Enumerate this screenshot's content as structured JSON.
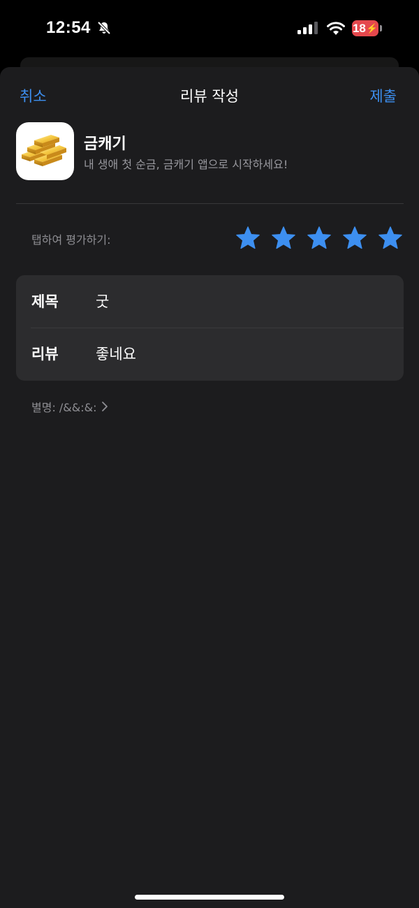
{
  "status_bar": {
    "time": "12:54",
    "battery_level": "18",
    "battery_color": "#e5484d",
    "icons": [
      "bell-slash-icon",
      "cellular-signal-icon",
      "wifi-icon",
      "battery-charging-icon"
    ]
  },
  "nav": {
    "cancel_label": "취소",
    "title": "리뷰 작성",
    "submit_label": "제출",
    "accent_color": "#3d8ff0"
  },
  "app": {
    "name": "금캐기",
    "subtitle": "내 생애 첫 순금, 금캐기 앱으로 시작하세요!",
    "icon": "gold-bars-icon"
  },
  "rating": {
    "label": "탭하여 평가하기:",
    "value": 5,
    "max": 5,
    "star_color": "#3d8ff0"
  },
  "form": {
    "title_label": "제목",
    "title_value": "굿",
    "review_label": "리뷰",
    "review_value": "좋네요"
  },
  "nickname": {
    "text": "별명: /&&:&:",
    "icon": "chevron-right-icon"
  }
}
